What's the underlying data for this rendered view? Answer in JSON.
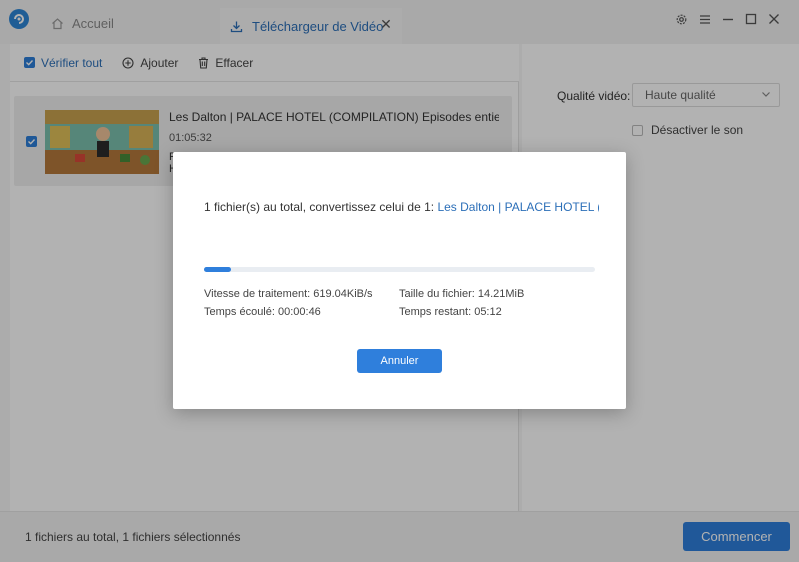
{
  "titlebar": {
    "home_tab_label": "Accueil",
    "active_tab_label": "Téléchargeur de Vidéo",
    "tab_close_glyph": "✕"
  },
  "toolbar": {
    "check_all_label": "Vérifier tout",
    "add_label": "Ajouter",
    "clear_label": "Effacer"
  },
  "video": {
    "title": "Les Dalton | PALACE HOTEL (COMPILATION) Episodes entiers en...",
    "duration": "01:05:32",
    "fragment_1": "F",
    "fragment_2": "H"
  },
  "settings": {
    "quality_label": "Qualité vidéo:",
    "quality_value": "Haute qualité",
    "mute_label": "Désactiver le son"
  },
  "footer": {
    "status": "1 fichiers au total, 1 fichiers sélectionnés",
    "start_label": "Commencer"
  },
  "dialog": {
    "message_prefix": "1 fichier(s) au total, convertissez celui de 1:",
    "message_link": "Les Dalton | PALACE HOTEL (CO...",
    "progress_fraction": 0.07,
    "speed": "Vitesse de traitement: 619.04KiB/s",
    "file_size": "Taille du fichier: 14.21MiB",
    "elapsed": "Temps écoulé: 00:00:46",
    "remaining": "Temps restant: 05:12",
    "cancel_label": "Annuler"
  },
  "colors": {
    "accent": "#2f7fdc",
    "link": "#2c6fb8"
  }
}
